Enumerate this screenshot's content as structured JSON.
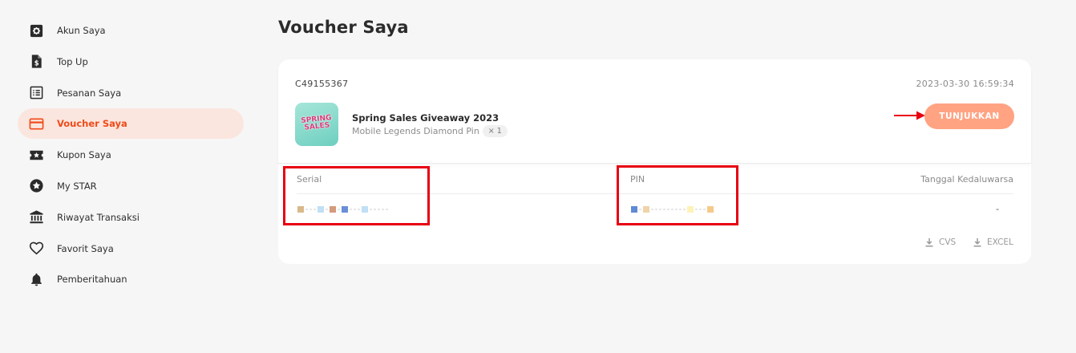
{
  "sidebar": {
    "items": [
      {
        "label": "Akun Saya",
        "icon": "gear-icon"
      },
      {
        "label": "Top Up",
        "icon": "dollar-document-icon"
      },
      {
        "label": "Pesanan Saya",
        "icon": "list-icon"
      },
      {
        "label": "Voucher Saya",
        "icon": "card-icon",
        "active": true
      },
      {
        "label": "Kupon Saya",
        "icon": "coupon-star-icon"
      },
      {
        "label": "My STAR",
        "icon": "star-circle-icon"
      },
      {
        "label": "Riwayat Transaksi",
        "icon": "bank-icon"
      },
      {
        "label": "Favorit Saya",
        "icon": "heart-icon"
      },
      {
        "label": "Pemberitahuan",
        "icon": "bell-icon"
      }
    ]
  },
  "main": {
    "title": "Voucher Saya",
    "voucher": {
      "order_id": "C49155367",
      "date": "2023-03-30 16:59:34",
      "thumbnail_text": "SPRING SALES",
      "product_name": "Spring Sales Giveaway 2023",
      "product_sub": "Mobile Legends Diamond Pin",
      "quantity": "× 1",
      "button_label": "TUNJUKKAN",
      "columns": {
        "serial": "Serial",
        "pin": "PIN",
        "expiry": "Tanggal Kedaluwarsa"
      },
      "expiry_value": "-",
      "downloads": {
        "csv": "CVS",
        "excel": "EXCEL"
      }
    }
  },
  "colors": {
    "accent": "#f04a17",
    "active_bg": "#fbe6df",
    "button": "#ffa383",
    "highlight": "#e80012",
    "background": "#f6f6f6"
  }
}
